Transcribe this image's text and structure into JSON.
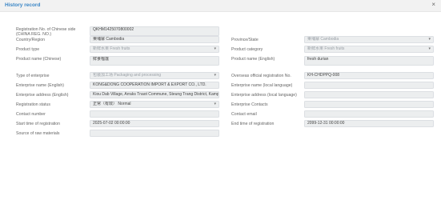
{
  "dialog": {
    "title": "History record",
    "close_label": "×"
  },
  "left": [
    {
      "label": "Registration No. of Chinese side (CHINA REG. NO.)",
      "value": "QKHM1425070800002",
      "type": "text"
    },
    {
      "label": "Country/Region",
      "value": "柬埔寨 Cambodia",
      "type": "text"
    },
    {
      "label": "Product type",
      "value": "新鲜水果 Fresh fruits",
      "type": "select",
      "muted": true
    },
    {
      "label": "Product name (Chinese)",
      "value": "鲜食榴莲",
      "type": "text"
    },
    {
      "label": "Type of enterprise",
      "value": "包装加工场 Packaging and processing",
      "type": "select",
      "muted": true
    },
    {
      "label": "Enterprise name (English)",
      "value": "KONG&DONG COOPERATION IMPORT & EXPORT CO., LTD.",
      "type": "text"
    },
    {
      "label": "Enterprise address (English)",
      "value": "Kiou Dab Village, Arraks Tnaot Commune, Steung Trang District, Kampong Cham Province",
      "type": "text"
    },
    {
      "label": "Registration status",
      "value": "正常（有效） Normal",
      "type": "select"
    },
    {
      "label": "Contact number",
      "value": "",
      "type": "text"
    },
    {
      "label": "Start time of registration",
      "value": "2025-07-02 00:00:00",
      "type": "text"
    },
    {
      "label": "Source of raw materials",
      "value": "",
      "type": "text"
    }
  ],
  "right": [
    {
      "label": "Province/State",
      "value": "柬埔寨 Cambodia",
      "type": "select",
      "muted": true
    },
    {
      "label": "Product category",
      "value": "新鲜水果 Fresh fruits",
      "type": "select",
      "muted": true
    },
    {
      "label": "Product name (English)",
      "value": "fresh durian",
      "type": "text"
    },
    {
      "label": "Overseas official registration No.",
      "value": "KH-CHDPPQ-008",
      "type": "text"
    },
    {
      "label": "Enterprise name (local language)",
      "value": "",
      "type": "text"
    },
    {
      "label": "Enterprise address (local language)",
      "value": "",
      "type": "text"
    },
    {
      "label": "Enterprise Contacts",
      "value": "",
      "type": "text"
    },
    {
      "label": "Contact email",
      "value": "",
      "type": "text"
    },
    {
      "label": "End time of registration",
      "value": "2099-12-31 00:00:00",
      "type": "text"
    }
  ]
}
